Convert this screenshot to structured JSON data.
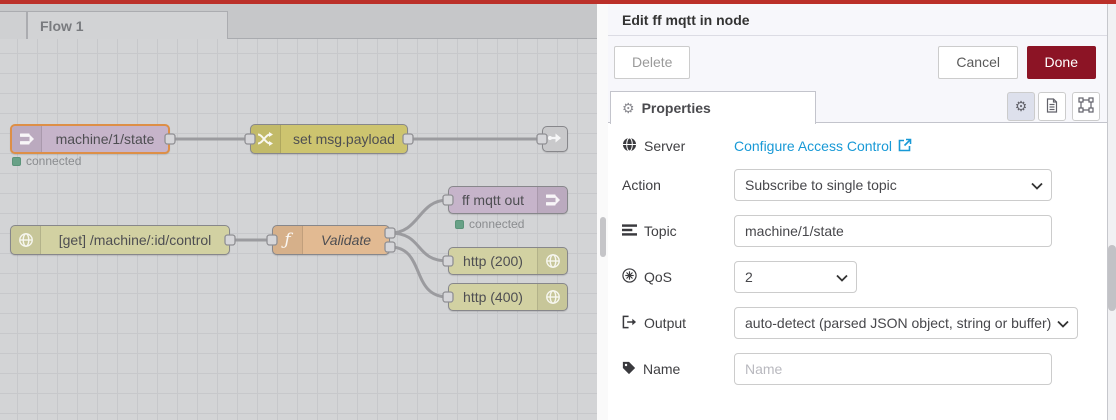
{
  "colors": {
    "top_bar": "#bb3029",
    "done_button": "#8c1425",
    "link_blue": "#1899d6",
    "selected_node_border": "#dd8f47",
    "status_green": "#68a187",
    "node_mqtt": "#c6b4ca",
    "node_change": "#cdc46f",
    "node_http": "#d2d1a2",
    "node_function": "#e2ba92",
    "node_link": "#c9c9cb"
  },
  "editor": {
    "flow_tab": "Flow 1",
    "nodes": {
      "mqtt_in": {
        "label": "machine/1/state",
        "status": "connected"
      },
      "change": {
        "label": "set msg.payload"
      },
      "http_in": {
        "label": "[get] /machine/:id/control"
      },
      "function": {
        "label": "Validate"
      },
      "mqtt_out": {
        "label": "ff mqtt out",
        "status": "connected"
      },
      "http_200": {
        "label": "http (200)"
      },
      "http_400": {
        "label": "http (400)"
      }
    }
  },
  "tray": {
    "title": "Edit ff mqtt in node",
    "buttons": {
      "delete": "Delete",
      "cancel": "Cancel",
      "done": "Done"
    },
    "tab": {
      "label": "Properties"
    },
    "fields": {
      "server": {
        "label": "Server",
        "link": "Configure Access Control"
      },
      "action": {
        "label": "Action",
        "value": "Subscribe to single topic"
      },
      "topic": {
        "label": "Topic",
        "value": "machine/1/state"
      },
      "qos": {
        "label": "QoS",
        "value": "2"
      },
      "output": {
        "label": "Output",
        "value": "auto-detect (parsed JSON object, string or buffer)"
      },
      "name": {
        "label": "Name",
        "placeholder": "Name"
      }
    }
  }
}
